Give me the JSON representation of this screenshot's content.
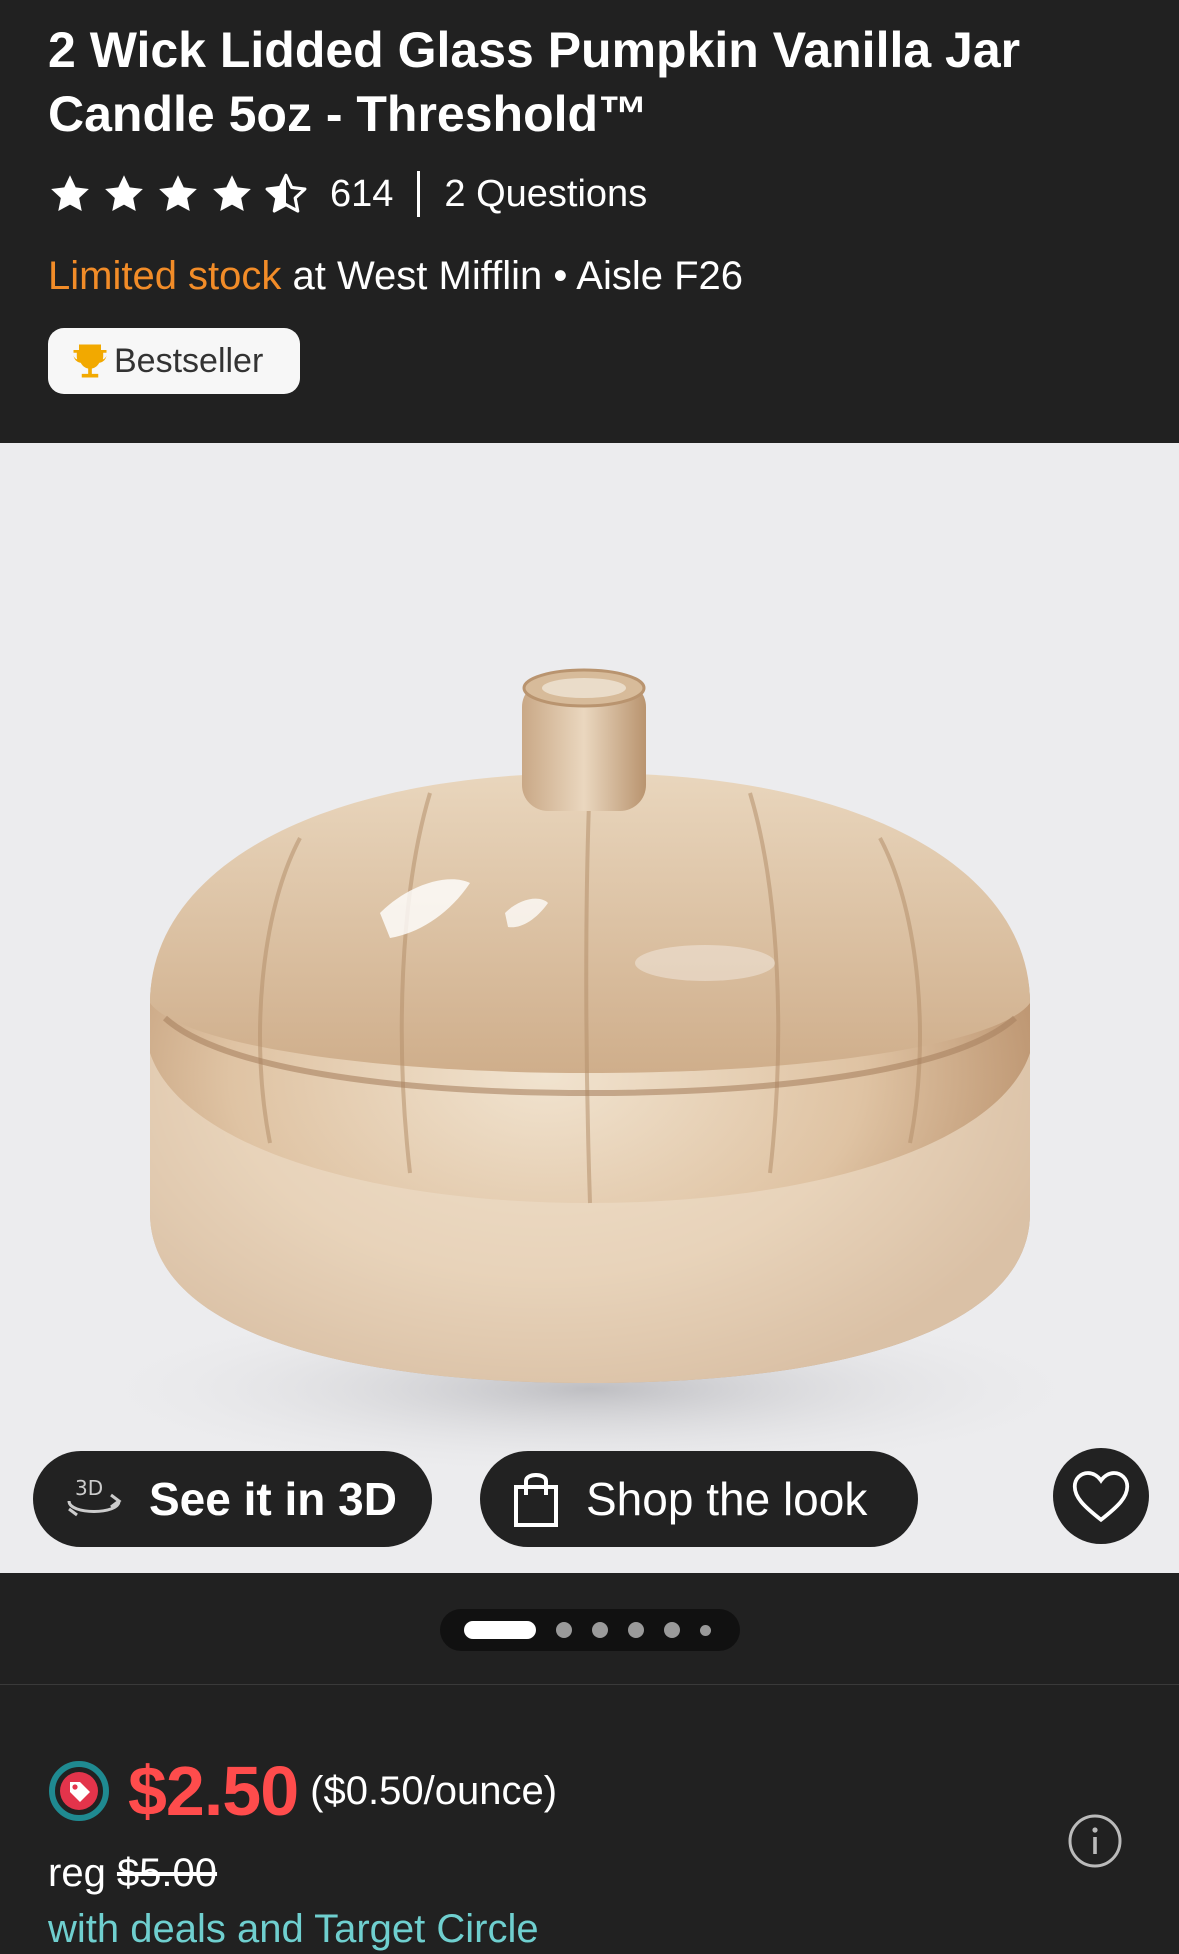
{
  "product": {
    "title": "2 Wick Lidded Glass Pumpkin Vanilla Jar Candle 5oz - Threshold™",
    "rating": 4.5,
    "rating_max": 5,
    "rating_count": "614",
    "questions": "2 Questions",
    "stock": {
      "status": "Limited stock",
      "location": "at West Mifflin • Aisle F26"
    },
    "badge": "Bestseller"
  },
  "image": {
    "buttons": {
      "see_3d": "See it in 3D",
      "see_3d_icon_text": "3D",
      "shop_look": "Shop the look"
    },
    "pager": {
      "count": 6,
      "active_index": 0
    }
  },
  "pricing": {
    "price": "$2.50",
    "unit_price": "($0.50/ounce)",
    "reg_label": "reg",
    "reg_price": "$5.00",
    "deals_text": "with deals and Target Circle"
  },
  "colors": {
    "background": "#212121",
    "stock_orange": "#f28c28",
    "price_red": "#ff4c4c",
    "deals_teal": "#6fcfcf",
    "image_bg": "#ececee"
  },
  "icons": {
    "rating": "star-icon",
    "badge": "trophy-icon",
    "see_3d": "rotate-3d-icon",
    "shop_look": "shopping-bag-icon",
    "favorite": "heart-icon",
    "price": "deal-tag-icon",
    "info": "info-icon"
  }
}
